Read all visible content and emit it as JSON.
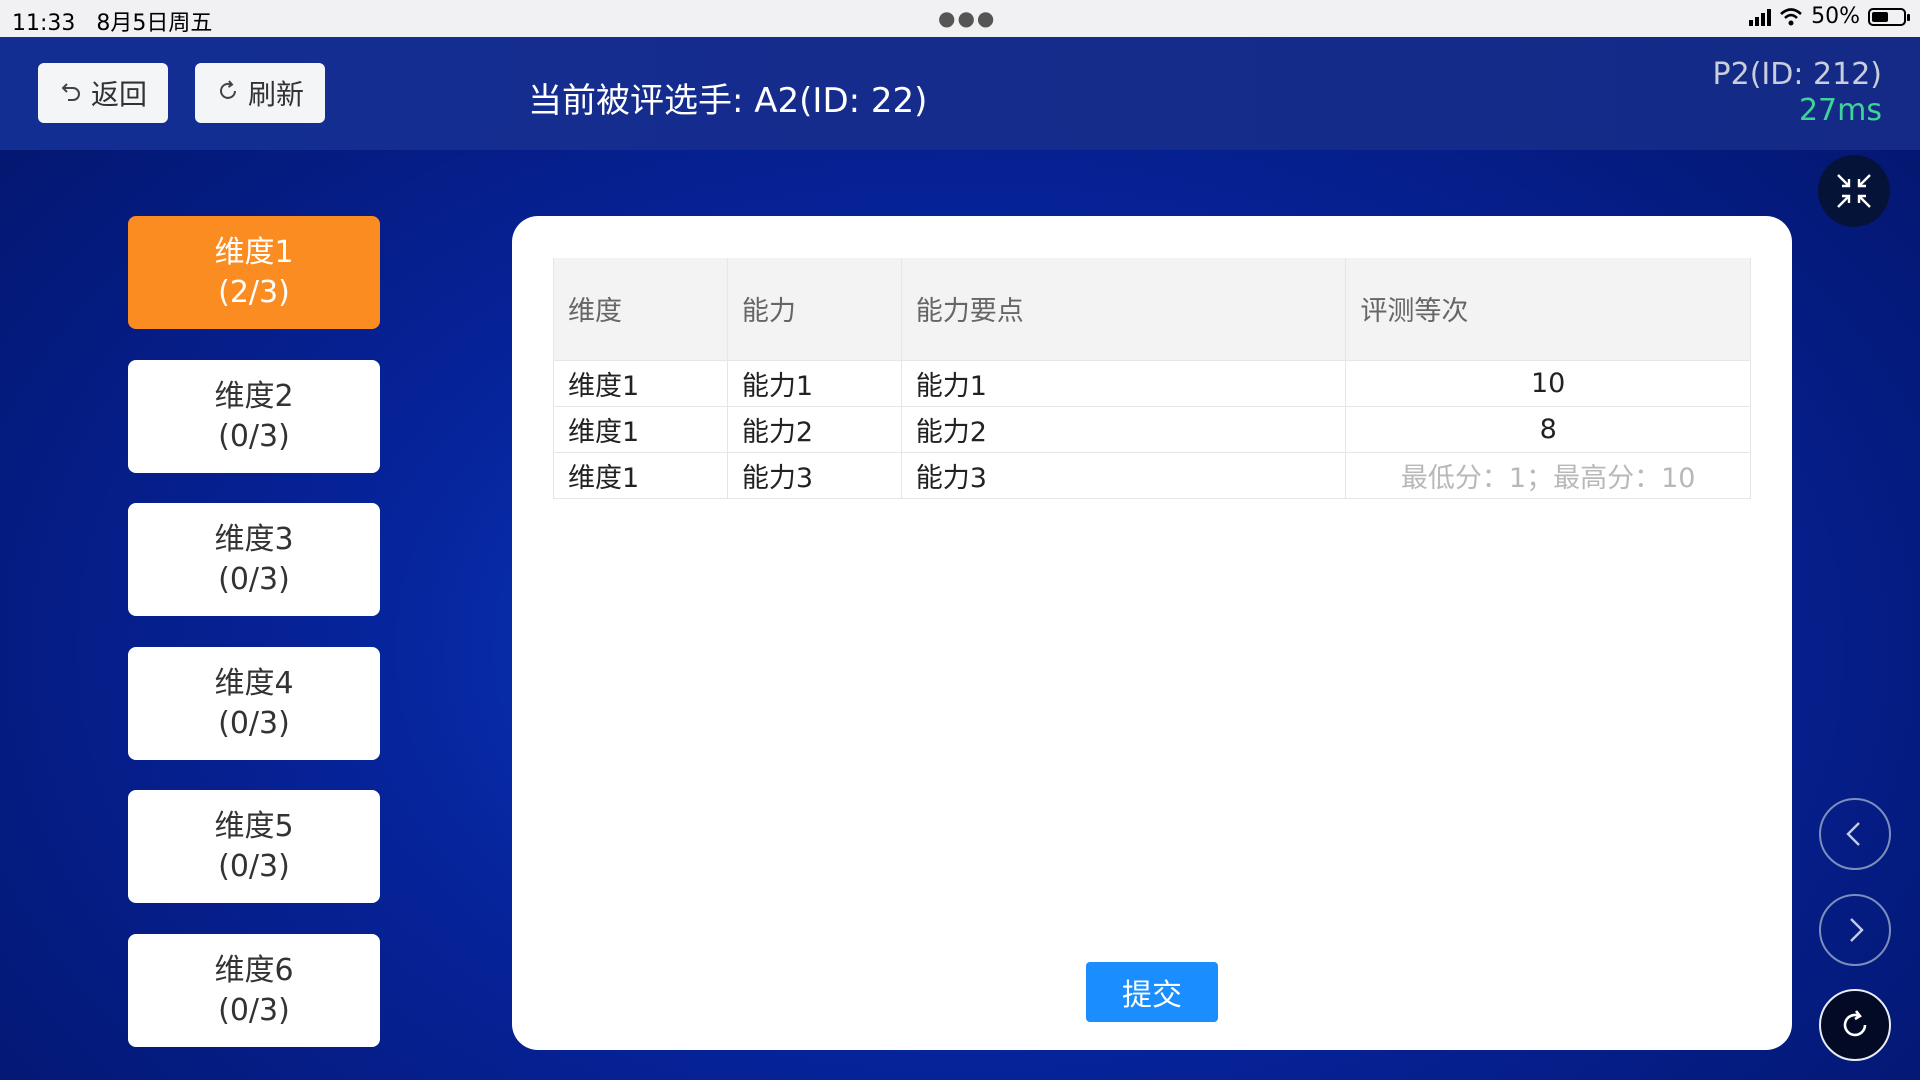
{
  "status_bar": {
    "time": "11:33",
    "date": "8月5日周五",
    "battery": "50%"
  },
  "header": {
    "back_label": "返回",
    "refresh_label": "刷新",
    "title": "当前被评选手: A2(ID: 22)",
    "user_id": "P2(ID: 212)",
    "latency": "27ms"
  },
  "sidebar": {
    "items": [
      {
        "name": "维度1",
        "progress": "(2/3)",
        "active": true
      },
      {
        "name": "维度2",
        "progress": "(0/3)",
        "active": false
      },
      {
        "name": "维度3",
        "progress": "(0/3)",
        "active": false
      },
      {
        "name": "维度4",
        "progress": "(0/3)",
        "active": false
      },
      {
        "name": "维度5",
        "progress": "(0/3)",
        "active": false
      },
      {
        "name": "维度6",
        "progress": "(0/3)",
        "active": false
      }
    ]
  },
  "table": {
    "headers": [
      "维度",
      "能力",
      "能力要点",
      "评测等次"
    ],
    "rows": [
      {
        "dimension": "维度1",
        "ability": "能力1",
        "point": "能力1",
        "score": "10"
      },
      {
        "dimension": "维度1",
        "ability": "能力2",
        "point": "能力2",
        "score": "8"
      },
      {
        "dimension": "维度1",
        "ability": "能力3",
        "point": "能力3",
        "score": ""
      }
    ],
    "score_placeholder": "最低分：1；最高分：10"
  },
  "submit_label": "提交",
  "colors": {
    "accent": "#fb8c22",
    "primary": "#1a8dff",
    "latency": "#3fd39a"
  },
  "icons": [
    "undo-icon",
    "refresh-icon",
    "collapse-icon",
    "chevron-left-icon",
    "chevron-right-icon",
    "reload-icon"
  ]
}
